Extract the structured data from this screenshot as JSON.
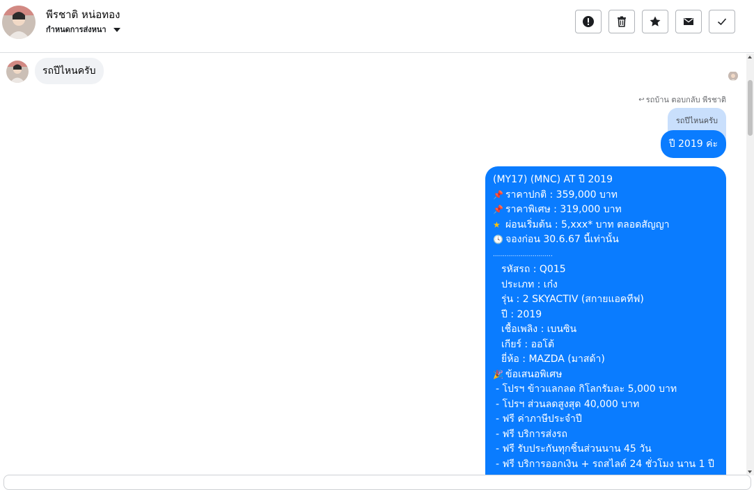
{
  "header": {
    "name": "พีรชาติ หน่อทอง",
    "status_label": "กำหนดการส่งหนา"
  },
  "toolbar": {
    "buttons": [
      {
        "icon": "alert-icon"
      },
      {
        "icon": "trash-icon"
      },
      {
        "icon": "star-icon"
      },
      {
        "icon": "mail-icon"
      },
      {
        "icon": "check-icon"
      }
    ]
  },
  "thread": {
    "incoming_message": "รถปีไหนครับ",
    "reply_meta": "รถบ้าน ตอบกลับ พีรชาติ",
    "quoted_text": "รถปีไหนครับ",
    "outgoing_short": "ปี 2019 ค่ะ",
    "outgoing_long": {
      "title": "(MY17) (MNC) AT ปี 2019",
      "price_normal": "ราคาปกติ : 359,000 บาท",
      "price_special": "ราคาพิเศษ : 319,000 บาท",
      "installment": "ผ่อนเริ่มต้น : 5,xxx* บาท ตลอดสัญญา",
      "booking": "จองก่อน 30.6.67 นี้เท่านั้น",
      "divider": "..............................",
      "details": [
        "รหัสรถ : Q015",
        "ประเภท : เก๋ง",
        "รุ่น : 2 SKYACTIV (สกายแอคทีฟ)",
        "ปี : 2019",
        "เชื้อเพลิง : เบนซิน",
        "เกียร์ : ออโต้",
        "ยี่ห้อ : MAZDA (มาสด้า)"
      ],
      "offer_title": "ข้อเสนอพิเศษ",
      "offers": [
        "- โปรฯ ข้าวแลกลด กิโลกรัมละ 5,000 บาท",
        "- โปรฯ ส่วนลดสูงสุด 40,000 บาท",
        "- ฟรี ค่าภาษีประจำปี",
        "- ฟรี บริการส่งรถ",
        "- ฟรี รับประกันทุกชิ้นส่วนนาน 45 วัน",
        "- ฟรี บริการออกเงิน + รถสไลด์ 24 ชั่วโมง นาน 1 ปี"
      ]
    }
  }
}
